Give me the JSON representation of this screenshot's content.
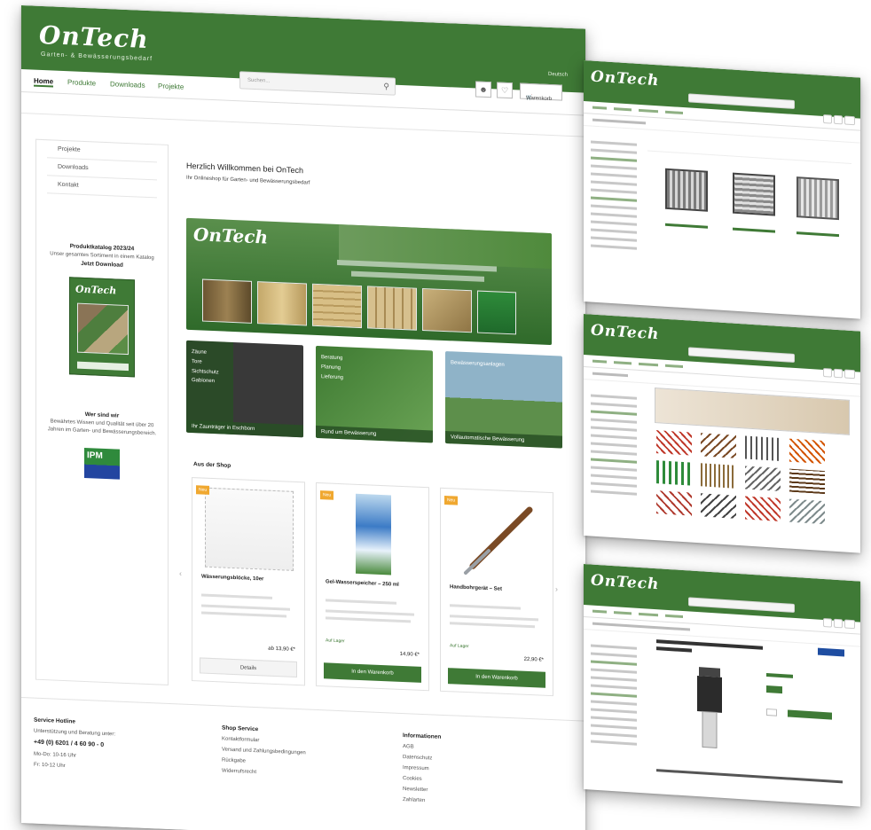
{
  "brand": {
    "logo_text": "OnTech",
    "tagline": "Garten- & Bewässerungsbedarf"
  },
  "colors": {
    "brand_green": "#3f7a36",
    "badge_orange": "#f0a830"
  },
  "header": {
    "search_placeholder": "Suchen...",
    "language": "Deutsch",
    "cart_label": "Warenkorb"
  },
  "nav": {
    "items": [
      "Home",
      "Produkte",
      "Downloads",
      "Projekte"
    ]
  },
  "sidebar": {
    "items": [
      "Projekte",
      "Downloads",
      "Kontakt"
    ],
    "catalog_title": "Produktkatalog 2023/24",
    "catalog_text": "Unser gesamtes Sortiment in einem Katalog",
    "catalog_link": "Jetzt Download",
    "catalog_logo": "OnTech",
    "about_title": "Wer sind wir",
    "about_text": "Bewährtes Wissen und Qualität seit über 20 Jahren im Garten- und Bewässerungsbereich.",
    "ipm_label": "IPM"
  },
  "main": {
    "welcome_title": "Herzlich Willkommen bei OnTech",
    "welcome_subtitle": "Ihr Onlineshop für Garten- und Bewässerungsbedarf",
    "banner_logo": "OnTech",
    "tiles": [
      {
        "lines": [
          "Zäune",
          "Tore",
          "Sichtschutz",
          "Gabionen"
        ],
        "caption": "Ihr Zaunträger in Eschborn"
      },
      {
        "lines": [
          "Beratung",
          "Planung",
          "Lieferung"
        ],
        "caption": "Rund um Bewässerung"
      },
      {
        "lines": [
          "Bewässerungsanlagen"
        ],
        "caption": "Vollautomatische Bewässerung"
      }
    ],
    "shop_title": "Aus der Shop",
    "products": [
      {
        "badge": "Neu",
        "name": "Wässerungsblöcke, 10er",
        "price": "ab 13,90 €*",
        "button": "Details"
      },
      {
        "badge": "Neu",
        "name": "Gel-Wasserspeicher – 250 ml",
        "price": "14,90 €*",
        "stock": "Auf Lager",
        "button": "In den Warenkorb"
      },
      {
        "badge": "Neu",
        "name": "Handbohrgerät – Set",
        "price": "22,90 €*",
        "stock": "Auf Lager",
        "button": "In den Warenkorb"
      }
    ],
    "watermark": "OnTech"
  },
  "footer": {
    "service_title": "Service Hotline",
    "service_text": "Unterstützung und Beratung unter:",
    "phone": "+49 (0) 6201 / 4 60 90 - 0",
    "hours_1": "Mo-Do: 10-16 Uhr",
    "hours_2": "Fr: 10-12 Uhr",
    "shop_service_title": "Shop Service",
    "shop_service_links": [
      "Kontaktformular",
      "Versand und Zahlungsbedingungen",
      "Rückgabe",
      "Widerrufsrecht"
    ],
    "info_title": "Informationen",
    "info_links": [
      "AGB",
      "Datenschutz",
      "Impressum",
      "Cookies",
      "Newsletter",
      "Zahlarten"
    ]
  },
  "side_pages": [
    {
      "logo": "OnTech",
      "name": "category-listing-page"
    },
    {
      "logo": "OnTech",
      "name": "tools-catalog-page"
    },
    {
      "logo": "OnTech",
      "name": "product-detail-page"
    }
  ]
}
